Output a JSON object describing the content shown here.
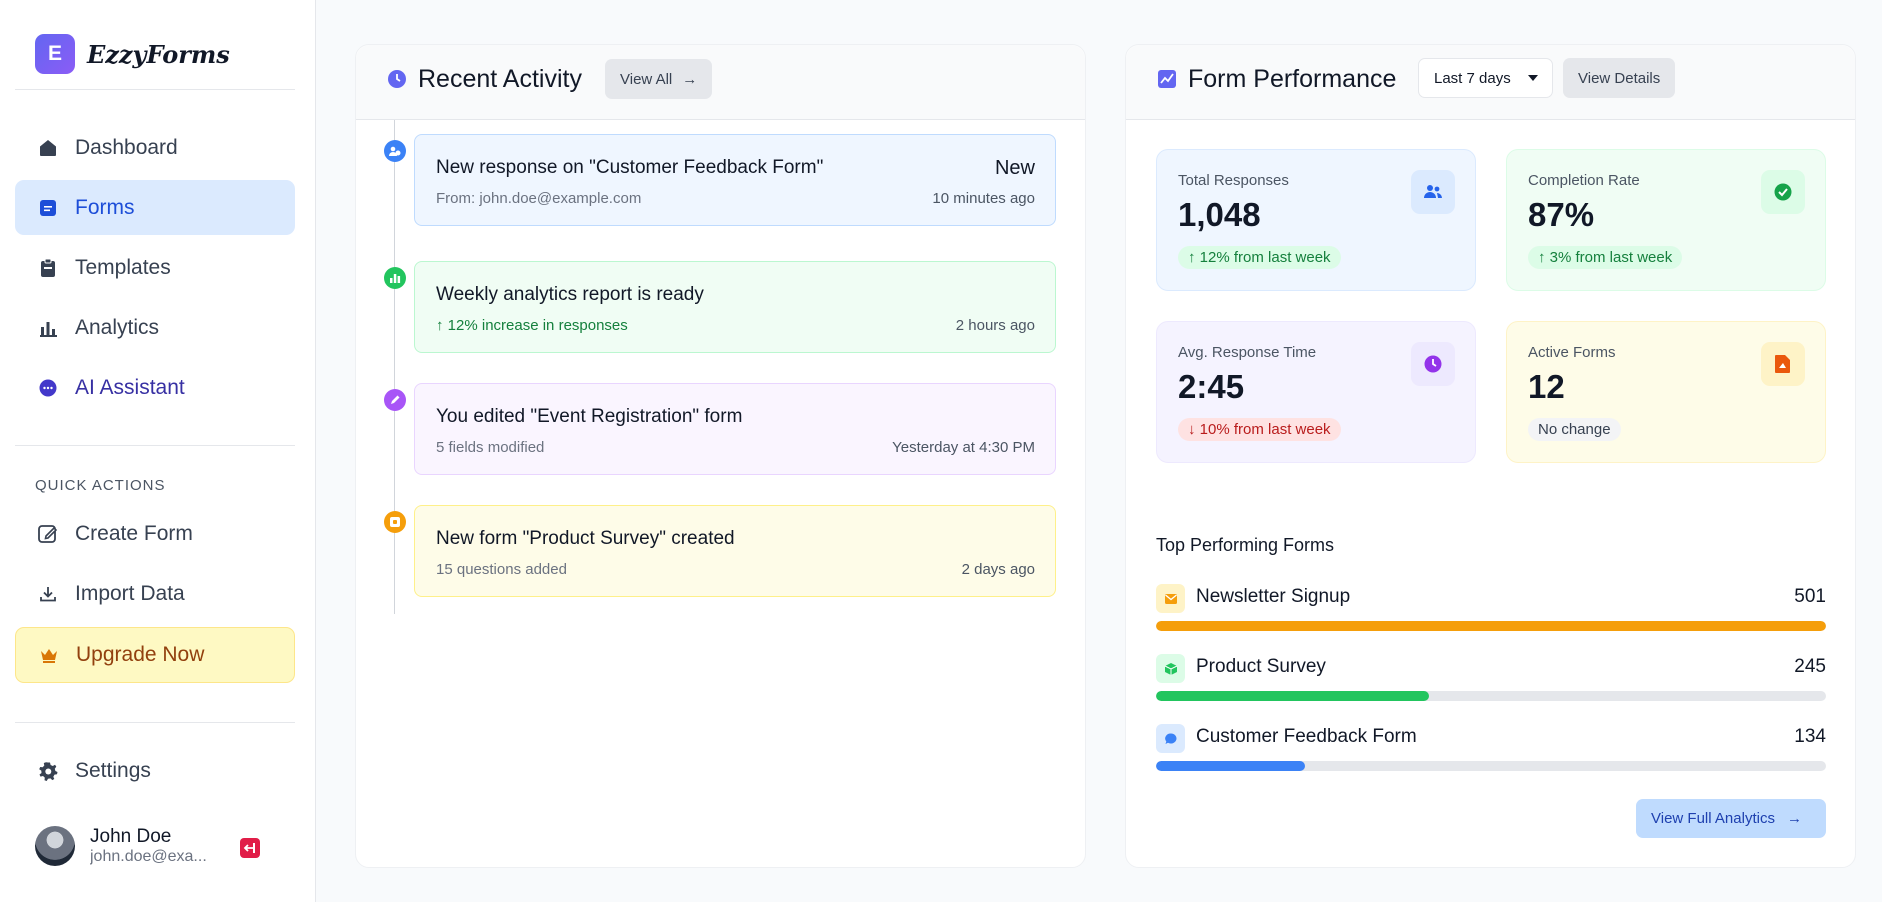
{
  "app": {
    "logo_letter": "E",
    "name": "EzzyForms"
  },
  "nav": [
    {
      "label": "Dashboard",
      "icon": "home-icon"
    },
    {
      "label": "Forms",
      "icon": "forms-icon",
      "active": true
    },
    {
      "label": "Templates",
      "icon": "templates-icon"
    },
    {
      "label": "Analytics",
      "icon": "analytics-icon"
    },
    {
      "label": "AI Assistant",
      "icon": "chat-icon"
    }
  ],
  "quick_actions": {
    "heading": "QUICK ACTIONS",
    "items": [
      {
        "label": "Create Form",
        "icon": "edit-icon"
      },
      {
        "label": "Import Data",
        "icon": "download-icon"
      }
    ]
  },
  "upgrade": {
    "label": "Upgrade Now",
    "icon": "crown-icon"
  },
  "settings": {
    "label": "Settings",
    "icon": "gear-icon"
  },
  "user": {
    "name": "John Doe",
    "email": "john.doe@exa..."
  },
  "recent_activity": {
    "title": "Recent Activity",
    "view_all": "View All",
    "items": [
      {
        "title": "New response on \"Customer Feedback Form\"",
        "sub": "From: john.doe@example.com",
        "time": "10 minutes ago",
        "badge": "New"
      },
      {
        "title": "Weekly analytics report is ready",
        "sub": "12% increase in responses",
        "time": "2 hours ago"
      },
      {
        "title": "You edited \"Event Registration\" form",
        "sub": "5 fields modified",
        "time": "Yesterday at 4:30 PM"
      },
      {
        "title": "New form \"Product Survey\" created",
        "sub": "15 questions added",
        "time": "2 days ago"
      }
    ]
  },
  "performance": {
    "title": "Form Performance",
    "range": "Last 7 days",
    "view_details": "View Details",
    "stats": [
      {
        "label": "Total Responses",
        "value": "1,048",
        "change": "12% from last week",
        "trend": "up"
      },
      {
        "label": "Completion Rate",
        "value": "87%",
        "change": "3% from last week",
        "trend": "up"
      },
      {
        "label": "Avg. Response Time",
        "value": "2:45",
        "change": "10% from last week",
        "trend": "down"
      },
      {
        "label": "Active Forms",
        "value": "12",
        "change": "No change",
        "trend": "none"
      }
    ],
    "top_heading": "Top Performing Forms",
    "top_forms": [
      {
        "name": "Newsletter Signup",
        "value": "501",
        "fraction": 1.0,
        "color": "#f59e0b"
      },
      {
        "name": "Product Survey",
        "value": "245",
        "fraction": 0.407,
        "color": "#22c55e"
      },
      {
        "name": "Customer Feedback Form",
        "value": "134",
        "fraction": 0.223,
        "color": "#3b82f6"
      }
    ],
    "view_full": "View Full Analytics"
  },
  "colors": {
    "primary": "#6366f1",
    "active_bg": "#dbeafe",
    "active_text": "#1d4ed8"
  }
}
